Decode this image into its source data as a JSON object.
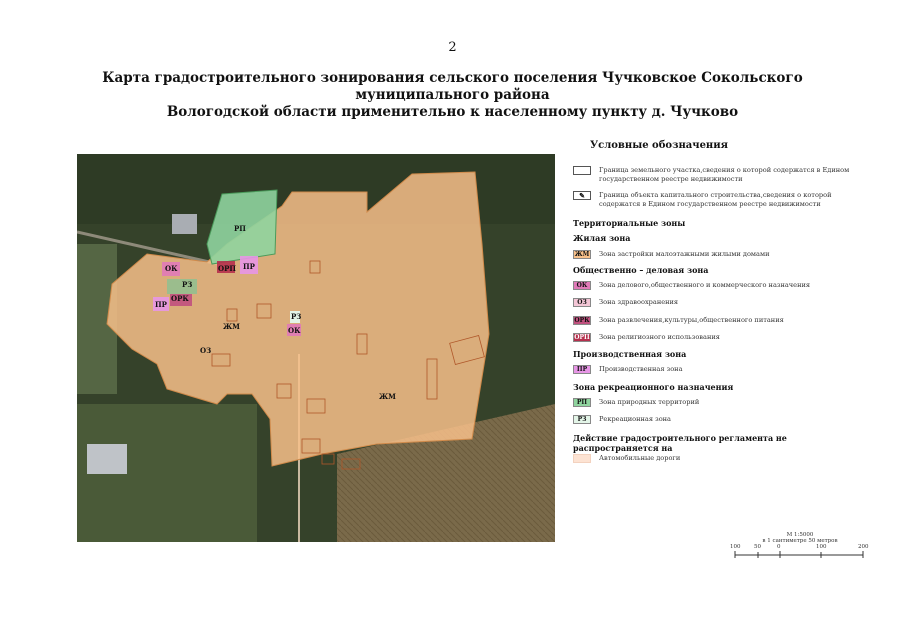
{
  "page_number": "2",
  "title_line1": "Карта градостроительного зонирования сельского поселения Чучковское Сокольского муниципального района",
  "title_line2": "Вологодской области применительно к населенному пункту д. Чучково",
  "map_labels": {
    "rp": "РП",
    "ok": "ОК",
    "orp": "ОРП",
    "ok2": "ОК",
    "pr1": "ПР",
    "rz": "РЗ",
    "ork": "ОРК",
    "pr2": "ПР",
    "zhm1": "ЖМ",
    "oz": "ОЗ",
    "rz2": "РЗ",
    "ok3": "ОК",
    "zhm2": "ЖМ"
  },
  "legend": {
    "title": "Условные обозначения",
    "boundary_parcel": "Граница земельного участка,сведения о которой содержатся в Едином государственном реестре недвижимости",
    "boundary_building": "Граница объекта капитального строительства,сведения о которой содержатся в Едином государственном реестре недвижимости",
    "territorial": "Территориальные зоны",
    "residential_heading": "Жилая зона",
    "zhm_code": "ЖМ",
    "zhm_text": "Зона застройки малоэтажными жилыми домами",
    "public_heading": "Общественно – деловая зона",
    "ok_code": "ОК",
    "ok_text": "Зона делового,общественного и коммерческого назначения",
    "oz_code": "ОЗ",
    "oz_text": "Зона здравоохранения",
    "ork_code": "ОРК",
    "ork_text": "Зона развлечения,культуры,общественного питания",
    "orp_code": "ОРП",
    "orp_text": "Зона религиозного использования",
    "industrial_heading": "Производственная зона",
    "pr_code": "ПР",
    "pr_text": "Производственная зона",
    "recreation_heading": "Зона рекреационного назначения",
    "rp_code": "РП",
    "rp_text": "Зона природных территорий",
    "rz_code": "РЗ",
    "rz_text": "Рекреационная зона",
    "no_reglament_heading": "Действие градостроительного регламента не распространяется на",
    "roads_text": "Автомобильные дороги"
  },
  "scale": {
    "ratio": "М 1:5000",
    "note": "в 1 сантиметре 50 метров",
    "ticks": [
      "100",
      "50",
      "0",
      "100",
      "200"
    ]
  },
  "colors": {
    "zhm": "#f7c08a",
    "ok": "#e07ab8",
    "oz": "#f4c6d6",
    "ork": "#c0507e",
    "orp": "#b5304d",
    "pr": "#e796e6",
    "rp": "#8fd49e",
    "rz": "#e3f5e8",
    "roads": "#fde3d3"
  }
}
